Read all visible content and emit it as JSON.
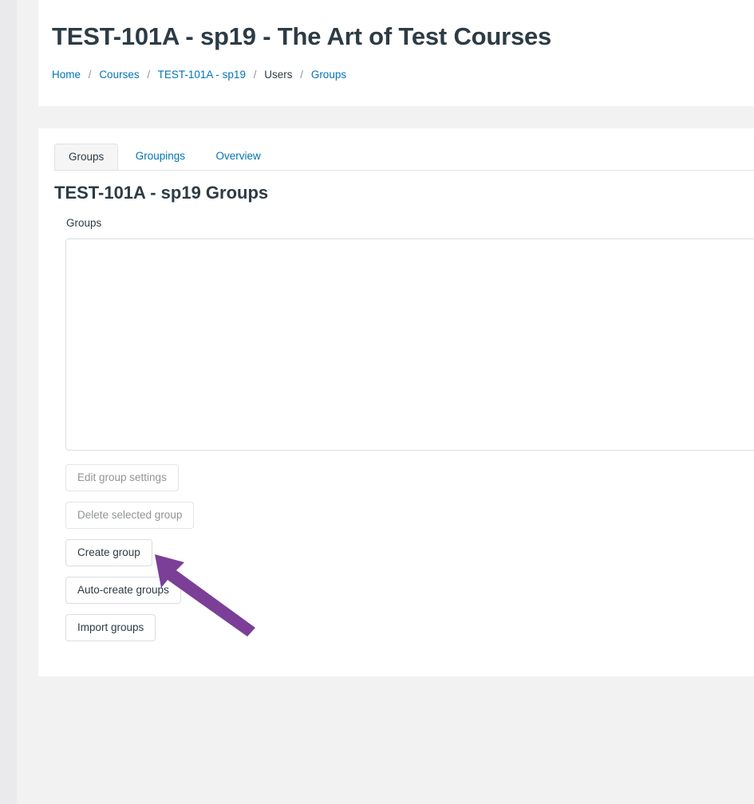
{
  "header": {
    "title": "TEST-101A - sp19 - The Art of Test Courses",
    "breadcrumb": [
      {
        "label": "Home",
        "link": true
      },
      {
        "label": "Courses",
        "link": true
      },
      {
        "label": "TEST-101A - sp19",
        "link": true
      },
      {
        "label": "Users",
        "link": false
      },
      {
        "label": "Groups",
        "link": true
      }
    ],
    "breadcrumb_separator": "/"
  },
  "tabs": [
    {
      "label": "Groups",
      "active": true
    },
    {
      "label": "Groupings",
      "active": false
    },
    {
      "label": "Overview",
      "active": false
    }
  ],
  "main": {
    "section_title": "TEST-101A - sp19 Groups",
    "groups_field": {
      "label": "Groups",
      "items": [],
      "empty": true
    },
    "buttons": [
      {
        "label": "Edit group settings",
        "name": "edit-group-settings-button",
        "disabled": true
      },
      {
        "label": "Delete selected group",
        "name": "delete-selected-group-button",
        "disabled": true
      },
      {
        "label": "Create group",
        "name": "create-group-button",
        "disabled": false
      },
      {
        "label": "Auto-create groups",
        "name": "auto-create-groups-button",
        "disabled": false
      },
      {
        "label": "Import groups",
        "name": "import-groups-button",
        "disabled": false
      }
    ]
  },
  "annotation": {
    "arrow_color": "#7b3f98",
    "points_at": "Create group"
  },
  "colors": {
    "link": "#0374b5",
    "text": "#2d3b45",
    "disabled_text": "#919496",
    "panel": "#ffffff",
    "page_background": "#f2f2f3",
    "rail": "#eaeaec",
    "border": "#dcdddf",
    "active_tab_background": "#f5f5f5",
    "arrow": "#7b3f98"
  }
}
